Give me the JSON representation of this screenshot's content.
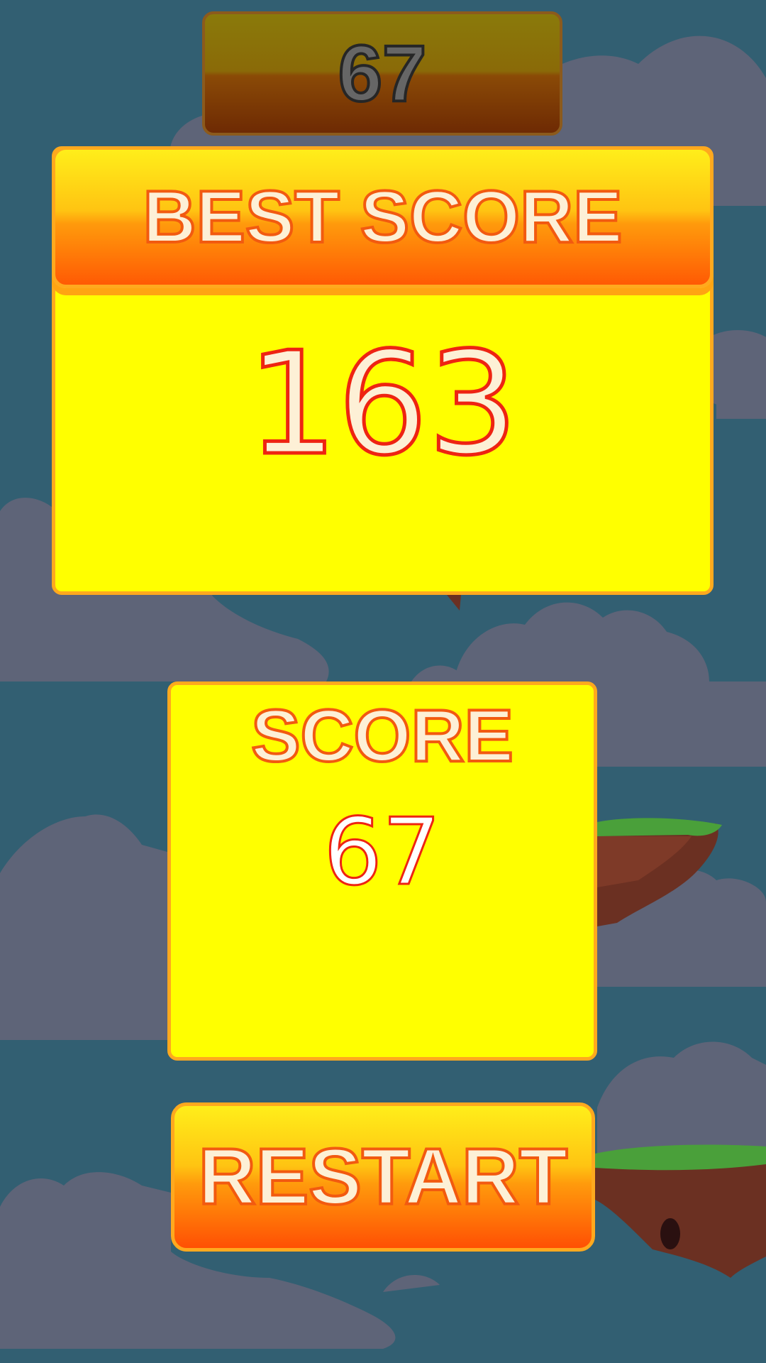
{
  "hud": {
    "current_score": "67"
  },
  "best_score_panel": {
    "title": "BEST SCORE",
    "value": "163"
  },
  "score_panel": {
    "title": "SCORE",
    "value": "67"
  },
  "restart_button": {
    "label": "RESTART"
  },
  "colors": {
    "sky": "#325f72",
    "cloud": "#5e6478",
    "panel_fill": "#ffff00",
    "panel_border": "#ffa91e",
    "title_text": "#fdf0d6",
    "title_stroke": "#f25a10",
    "number_stroke": "#ee2412",
    "grass": "#4aa03a",
    "dirt": "#6b3022"
  }
}
